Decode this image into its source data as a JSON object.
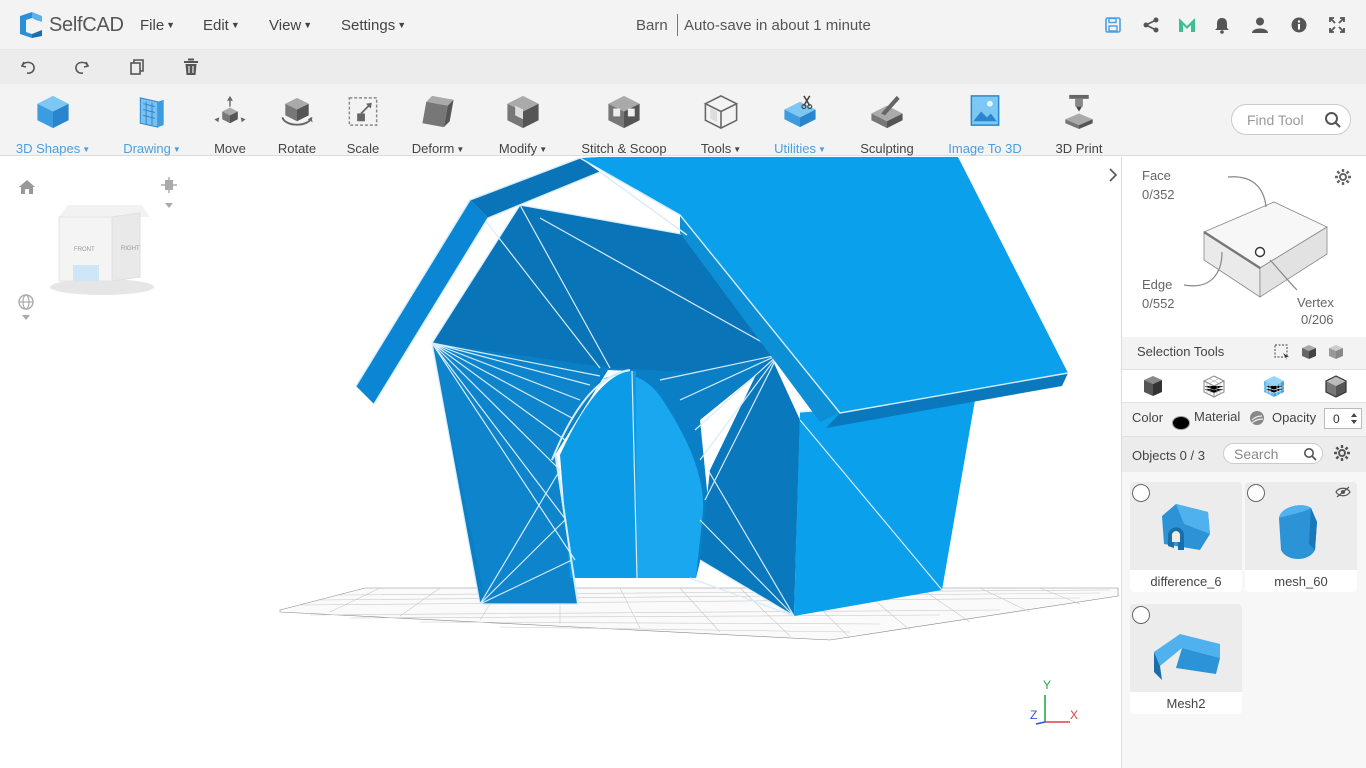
{
  "app": {
    "name": "SelfCAD"
  },
  "menu": [
    {
      "label": "File"
    },
    {
      "label": "Edit"
    },
    {
      "label": "View"
    },
    {
      "label": "Settings"
    }
  ],
  "document": {
    "title": "Barn",
    "autosave": "Auto-save in about 1 minute"
  },
  "top_icons": [
    "save-icon",
    "share-icon",
    "m-logo-icon",
    "bell-icon",
    "user-icon",
    "info-icon",
    "fullscreen-icon"
  ],
  "quick_actions": [
    "undo-icon",
    "redo-icon",
    "copy-icon",
    "delete-icon"
  ],
  "ribbon": {
    "tools": [
      {
        "label": "3D Shapes",
        "dropdown": true,
        "highlight": true
      },
      {
        "label": "Drawing",
        "dropdown": true,
        "highlight": true
      },
      {
        "label": "Move"
      },
      {
        "label": "Rotate"
      },
      {
        "label": "Scale"
      },
      {
        "label": "Deform",
        "dropdown": true
      },
      {
        "label": "Modify",
        "dropdown": true
      },
      {
        "label": "Stitch & Scoop"
      },
      {
        "label": "Tools",
        "dropdown": true
      },
      {
        "label": "Utilities",
        "dropdown": true,
        "highlight": true
      },
      {
        "label": "Sculpting"
      },
      {
        "label": "Image To 3D",
        "highlight": true
      },
      {
        "label": "3D Print"
      }
    ],
    "find_placeholder": "Find Tool"
  },
  "viewcube": {
    "front": "FRONT",
    "right": "RIGHT"
  },
  "axes": {
    "x": "X",
    "y": "Y",
    "z": "Z"
  },
  "selection": {
    "face_label": "Face",
    "face_count": "0/352",
    "edge_label": "Edge",
    "edge_count": "0/552",
    "vertex_label": "Vertex",
    "vertex_count": "0/206",
    "tools_label": "Selection Tools"
  },
  "properties": {
    "color_label": "Color",
    "material_label": "Material",
    "opacity_label": "Opacity",
    "opacity_value": "0",
    "color_value": "#000000"
  },
  "objects": {
    "header": "Objects 0 / 3",
    "search_placeholder": "Search",
    "items": [
      {
        "name": "difference_6"
      },
      {
        "name": "mesh_60",
        "hidden": true
      },
      {
        "name": "Mesh2"
      }
    ]
  },
  "colors": {
    "accent": "#4a9fe0",
    "model_light": "#10a0ec",
    "model_dark": "#0a7fc6"
  }
}
